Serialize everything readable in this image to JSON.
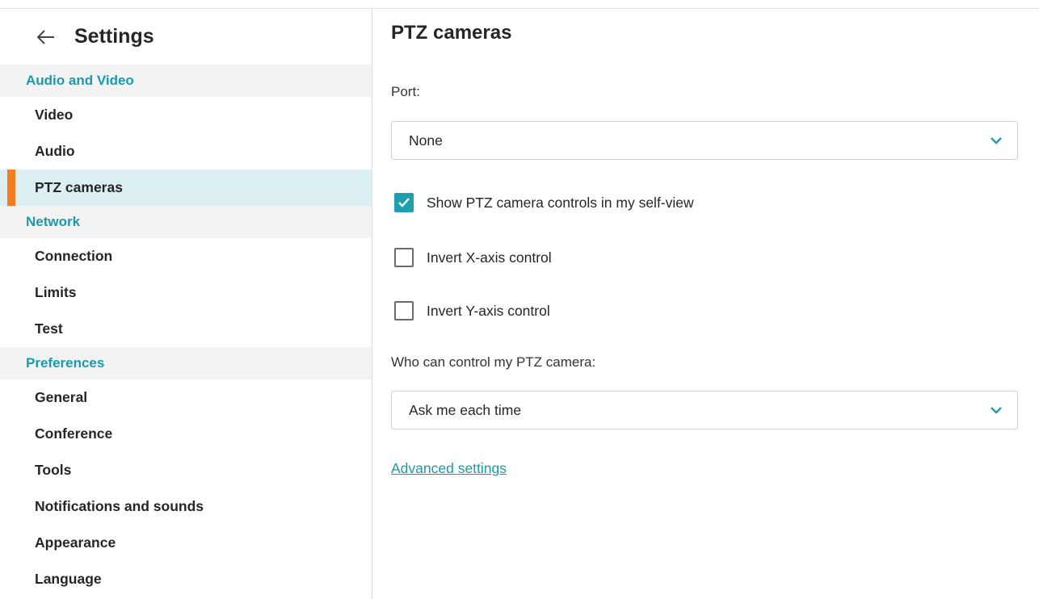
{
  "sidebar": {
    "title": "Settings",
    "back_icon": "arrow-left-icon",
    "sections": [
      {
        "label": "Audio and Video",
        "items": [
          "Video",
          "Audio",
          "PTZ cameras"
        ]
      },
      {
        "label": "Network",
        "items": [
          "Connection",
          "Limits",
          "Test"
        ]
      },
      {
        "label": "Preferences",
        "items": [
          "General",
          "Conference",
          "Tools",
          "Notifications and sounds",
          "Appearance",
          "Language"
        ]
      }
    ],
    "active_item": "PTZ cameras",
    "active_indicator_color": "#f47d22",
    "active_bg_color": "#dceff3"
  },
  "main": {
    "title": "PTZ cameras",
    "port": {
      "label": "Port:",
      "value": "None"
    },
    "checkboxes": [
      {
        "label": "Show PTZ camera controls in my self-view",
        "checked": true
      },
      {
        "label": "Invert X-axis control",
        "checked": false
      },
      {
        "label": "Invert Y-axis control",
        "checked": false
      }
    ],
    "who_control": {
      "label": "Who can control my PTZ camera:",
      "value": "Ask me each time"
    },
    "advanced_link": "Advanced settings"
  },
  "colors": {
    "accent": "#1b9aab",
    "checkbox_checked": "#1f9eb0",
    "section_bg": "#f3f3f3"
  }
}
